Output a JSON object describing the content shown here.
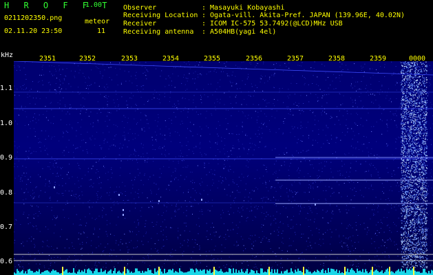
{
  "header": {
    "title": "H R O F F T",
    "version": "1.00",
    "file_name": "0211202350.png",
    "timestamp": "02.11.20 23:50",
    "meteor_label": "meteor",
    "meteor_count": "11"
  },
  "info": {
    "observer_label": "Observer",
    "observer_value": ": Masayuki Kobayashi",
    "location_label": "Receiving Location",
    "location_value": ": Ogata-vill. Akita-Pref. JAPAN (139.96E, 40.02N)",
    "receiver_label": "Receiver",
    "receiver_value": ": ICOM IC-575 53.7492(@LCD)MHz USB",
    "antenna_label": "Receiving antenna",
    "antenna_value": ": A504HB(yagi 4el)"
  },
  "plot": {
    "y_unit": "kHz",
    "y_ticks": [
      "1.1",
      "1.0",
      "0.9",
      "0.8",
      "0.7",
      "0.6"
    ],
    "x_ticks": [
      "2351",
      "2352",
      "2353",
      "2354",
      "2355",
      "2356",
      "2357",
      "2358",
      "2359",
      "0000"
    ]
  },
  "colors": {
    "background": "#000000",
    "spectrogram": "#00007c",
    "label_yellow": "#ffff00",
    "label_green": "#33ff33"
  }
}
